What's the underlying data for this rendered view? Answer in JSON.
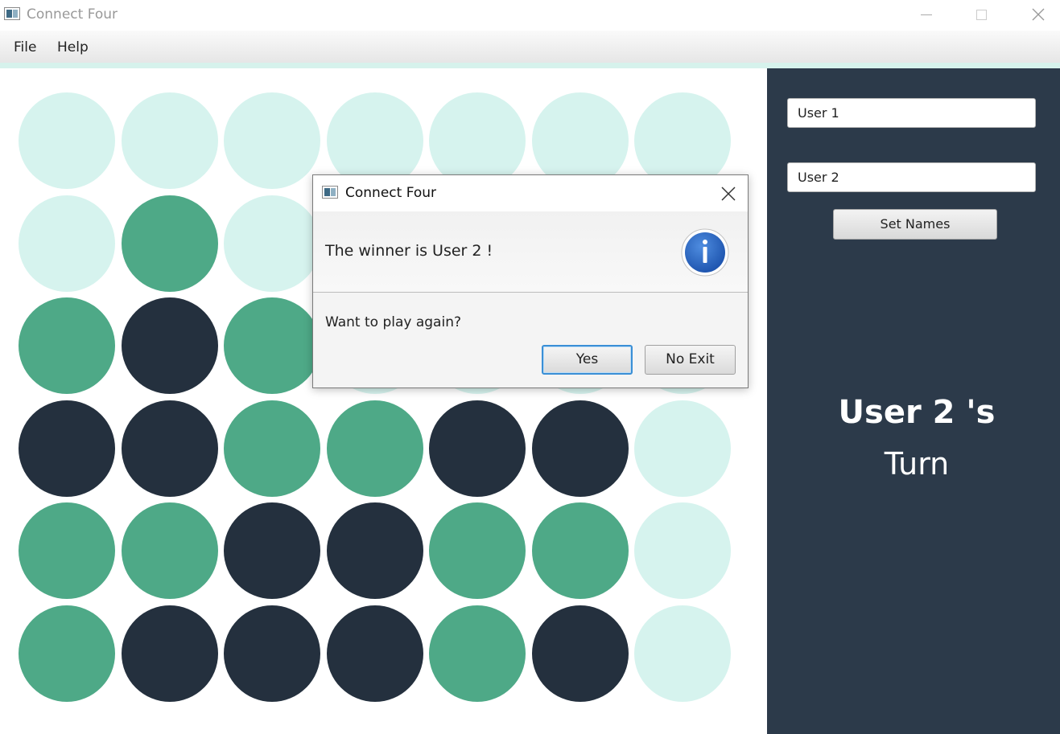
{
  "window": {
    "title": "Connect Four"
  },
  "menu": {
    "items": [
      "File",
      "Help"
    ]
  },
  "board": {
    "rows": [
      [
        "empty",
        "empty",
        "empty",
        "empty",
        "empty",
        "empty",
        "empty"
      ],
      [
        "empty",
        "green",
        "empty",
        "empty",
        "empty",
        "empty",
        "empty"
      ],
      [
        "green",
        "dark",
        "green",
        "empty",
        "empty",
        "empty",
        "empty"
      ],
      [
        "dark",
        "dark",
        "green",
        "green",
        "dark",
        "dark",
        "empty"
      ],
      [
        "green",
        "green",
        "dark",
        "dark",
        "green",
        "green",
        "empty"
      ],
      [
        "green",
        "dark",
        "dark",
        "dark",
        "green",
        "dark",
        "empty"
      ]
    ],
    "colors": {
      "empty": "#d6f3ee",
      "green": "#4ea987",
      "dark": "#24303e"
    }
  },
  "side_panel": {
    "player1_name": "User 1",
    "player2_name": "User 2",
    "set_names_label": "Set Names",
    "turn_name": "User 2 's",
    "turn_label": "Turn",
    "background": "#2c3a4a"
  },
  "dialog": {
    "title": "Connect Four",
    "header_text": "The winner is User 2 !",
    "content_text": "Want to play again?",
    "yes_label": "Yes",
    "no_label": "No Exit",
    "icon": "info-icon"
  }
}
